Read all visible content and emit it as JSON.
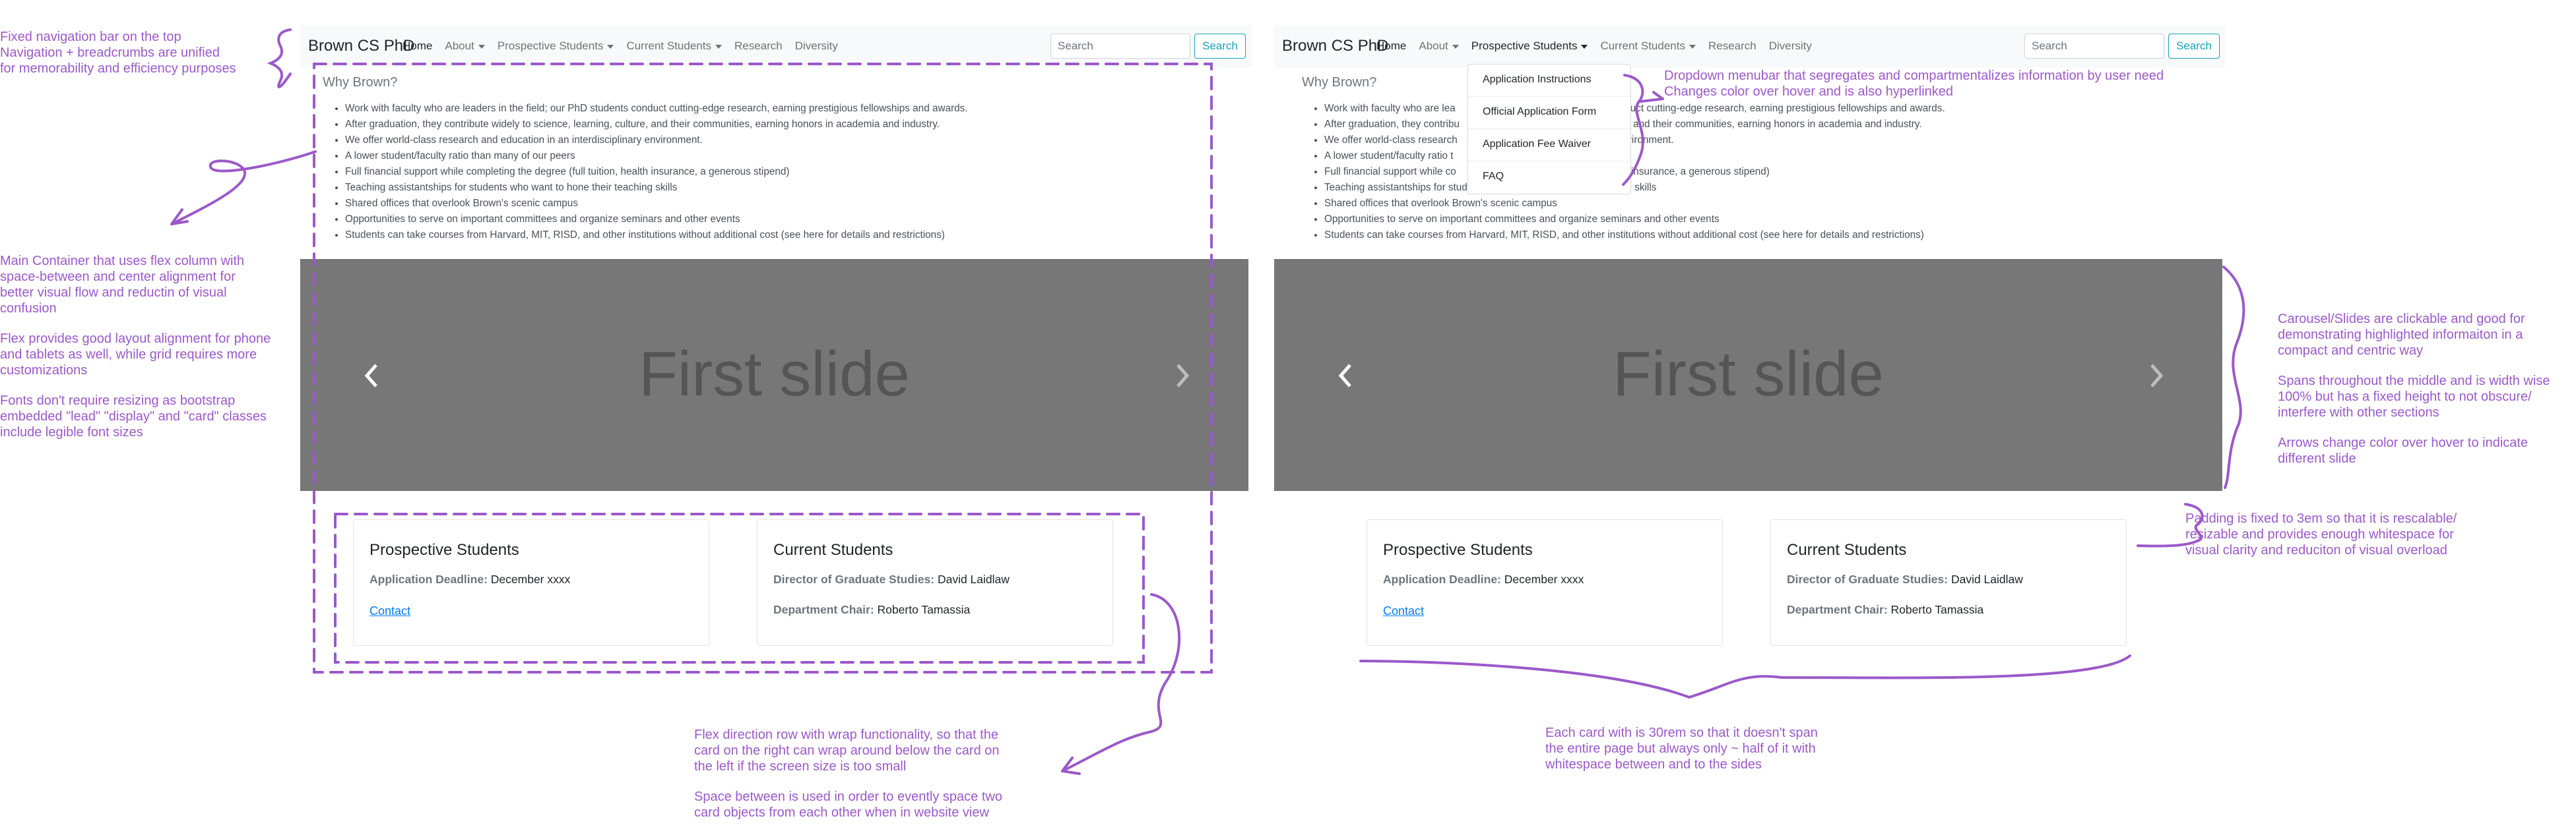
{
  "annotations": {
    "navbar": [
      "Fixed navigation bar on the top",
      "Navigation + breadcrumbs are unified",
      "for memorability and efficiency purposes"
    ],
    "container": [
      "Main Container that uses flex column with",
      "space-between and center alignment for",
      "better visual flow and reductin of visual",
      "confusion"
    ],
    "flex": [
      "Flex provides good layout alignment for phone",
      "and tablets as well, while grid requires more",
      "customizations"
    ],
    "fonts": [
      "Fonts don't require resizing as bootstrap",
      "embedded \"lead\" \"display\" and \"card\" classes",
      "include legible font sizes"
    ],
    "row_wrap": [
      "Flex direction row with wrap functionality, so that the",
      "card on the right can wrap around below the card on",
      "the left if the screen size is too small"
    ],
    "space_between": [
      "Space between is used in order to evently space two",
      "card objects from each other when in website view"
    ],
    "dropdown": [
      "Dropdown menubar that segregates and compartmentalizes information by user need",
      "Changes color over hover and is also hyperlinked"
    ],
    "carousel": [
      "Carousel/Slides are clickable and good for",
      "demonstrating highlighted informaiton in a",
      "compact and centric way"
    ],
    "spans": [
      "Spans throughout the middle and is width wise",
      "100% but has a fixed height to not obscure/",
      "interfere with other sections"
    ],
    "arrows": [
      "Arrows change color over hover to indicate",
      "different slide"
    ],
    "padding": [
      "Padding is fixed to 3em so that it is rescalable/",
      "resizable and provides enough whitespace for",
      "visual clarity and reduciton of visual overload"
    ],
    "card_width": [
      "Each card with is 30rem so that it doesn't span",
      "the entire page but always only ~ half of it with",
      "whitespace between and to the sides"
    ]
  },
  "site": {
    "brand": "Brown CS PhD",
    "nav": [
      "Home",
      "About",
      "Prospective Students",
      "Current Students",
      "Research",
      "Diversity"
    ],
    "search_placeholder": "Search",
    "search_button": "Search",
    "why_title": "Why Brown?",
    "bullets": [
      "Work with faculty who are leaders in the field; our PhD students conduct cutting-edge research, earning prestigious fellowships and awards.",
      "After graduation, they contribute widely to science, learning, culture, and their communities, earning honors in academia and industry.",
      "We offer world-class research and education in an interdisciplinary environment.",
      "A lower student/faculty ratio than many of our peers",
      "Full financial support while completing the degree (full tuition, health insurance, a generous stipend)",
      "Teaching assistantships for students who want to hone their teaching skills",
      "Shared offices that overlook Brown's scenic campus",
      "Opportunities to serve on important committees and organize seminars and other events",
      "Students can take courses from Harvard, MIT, RISD, and other institutions without additional cost (see here for details and restrictions)"
    ],
    "right_bullets": [
      "Work with faculty who are lea",
      "After graduation, they contribu",
      "We offer world-class research",
      "A lower student/faculty ratio t",
      "Full financial support while co",
      "Teaching assistantships for students who want to hone their teaching skills",
      "Shared offices that overlook Brown's scenic campus",
      "Opportunities to serve on important committees and organize seminars and other events",
      "Students can take courses from Harvard, MIT, RISD, and other institutions without additional cost (see here for details and restrictions)"
    ],
    "right_bullet_tails": [
      "nduct cutting-edge research, earning prestigious fellowships and awards.",
      "y, and their communities, earning honors in academia and industry.",
      "nvironment.",
      "",
      "th insurance, a generous stipend)"
    ],
    "slide_label": "First slide",
    "card1": {
      "title": "Prospective Students",
      "deadline_label": "Application Deadline:",
      "deadline_value": "December xxxx",
      "link": "Contact"
    },
    "card2": {
      "title": "Current Students",
      "dgs_label": "Director of Graduate Studies:",
      "dgs_value": "David Laidlaw",
      "chair_label": "Department Chair:",
      "chair_value": "Roberto Tamassia"
    },
    "dropdown_items": [
      "Application Instructions",
      "Official Application Form",
      "Application Fee Waiver",
      "FAQ"
    ]
  },
  "colors": {
    "annotation": "#9b59c9",
    "carousel": "#777777",
    "accent": "#17a2b8",
    "link": "#007bff"
  }
}
